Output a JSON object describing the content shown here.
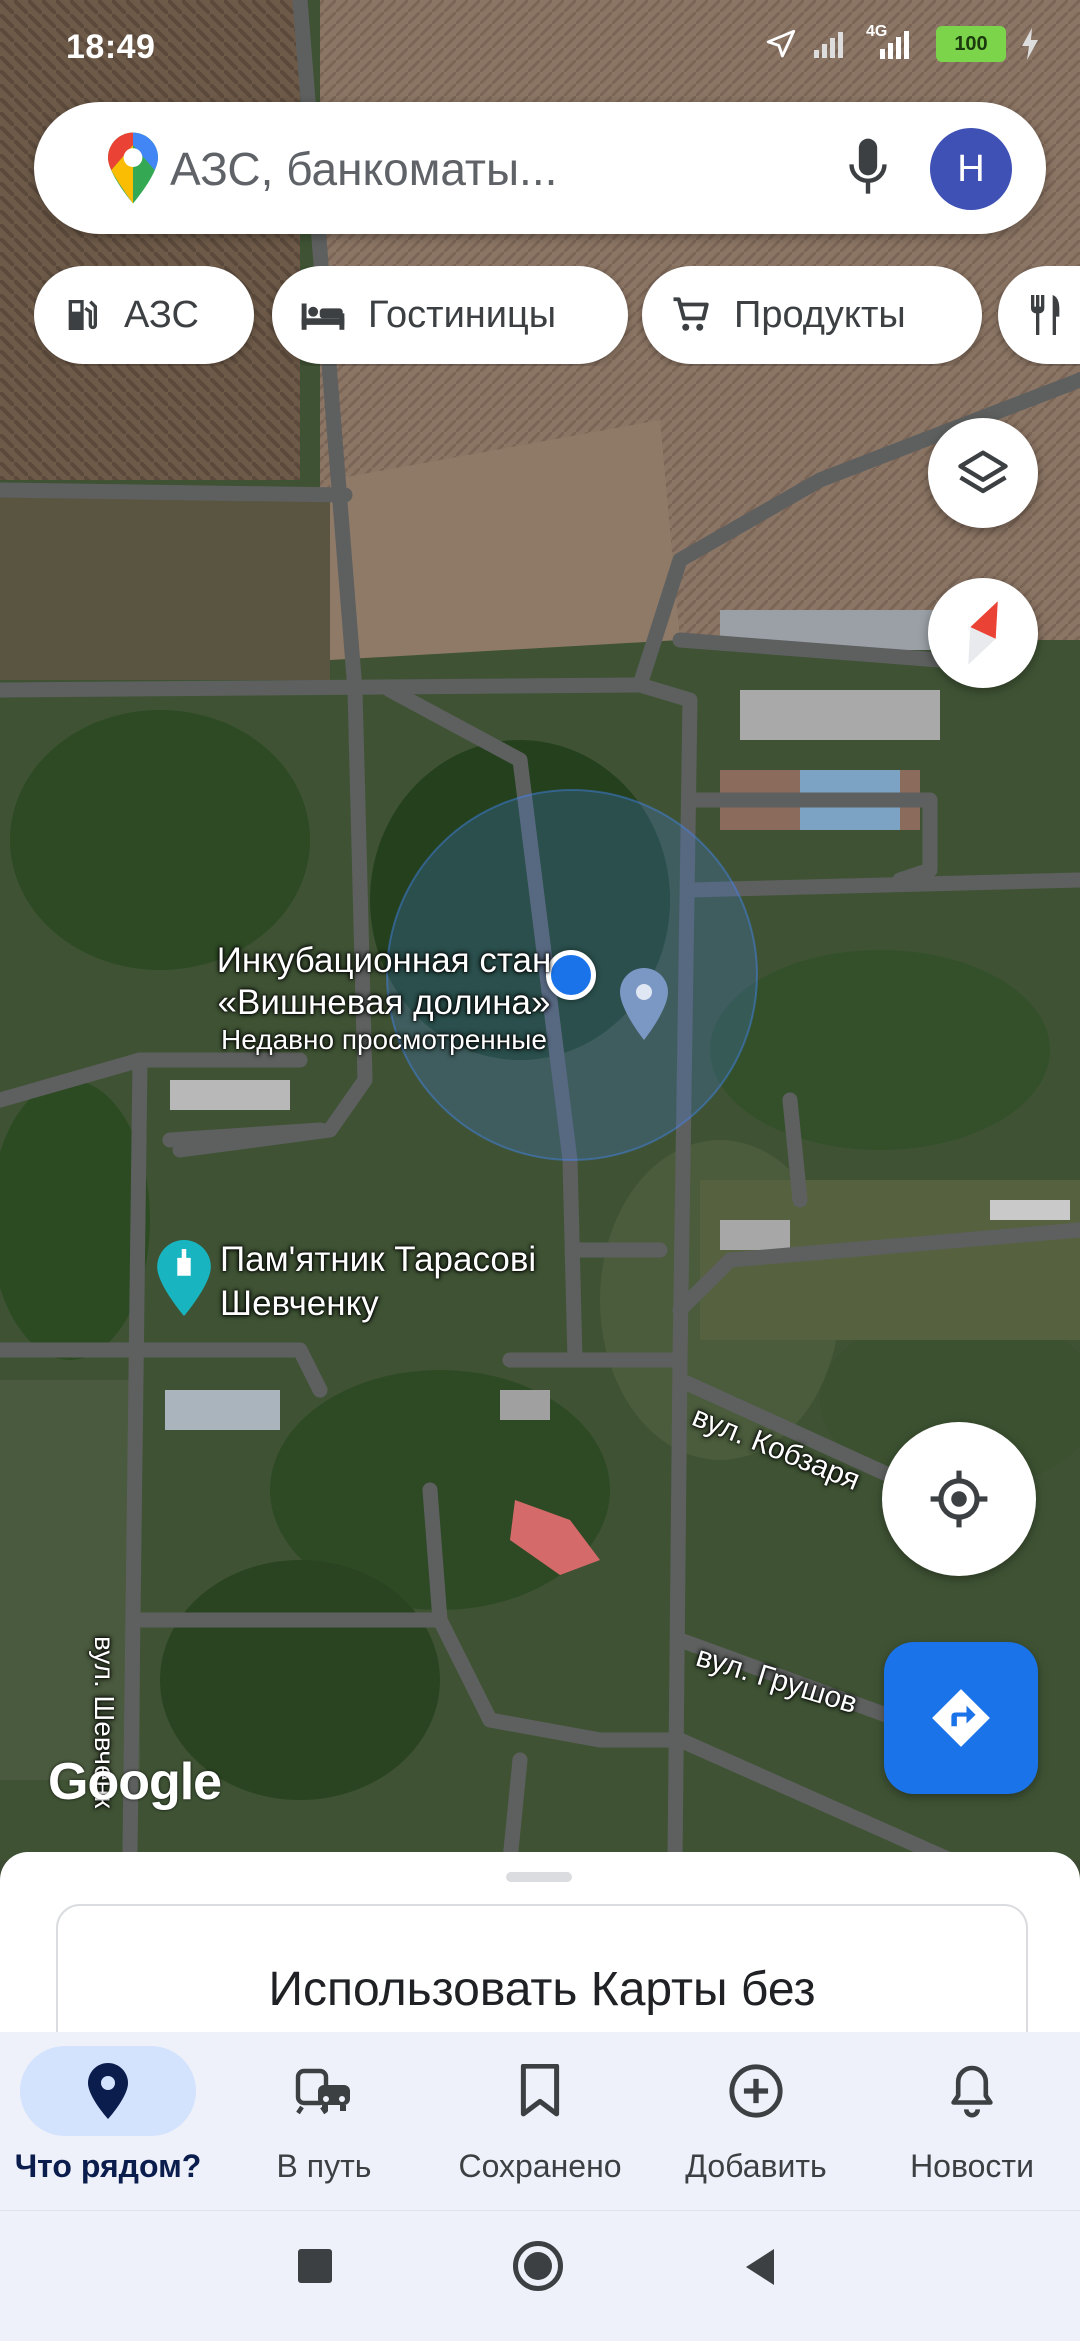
{
  "status_bar": {
    "time": "18:49",
    "network": "4G",
    "battery": "100"
  },
  "search": {
    "placeholder": "АЗС, банкоматы...",
    "avatar_letter": "Н"
  },
  "chips": [
    {
      "label": "АЗС",
      "icon": "gas-station-icon"
    },
    {
      "label": "Гостиницы",
      "icon": "hotel-bed-icon"
    },
    {
      "label": "Продукты",
      "icon": "shopping-cart-icon"
    },
    {
      "label": "",
      "icon": "restaurant-icon"
    }
  ],
  "map": {
    "place_label_line1": "Инкубационная стан",
    "place_label_line2": "«Вишневая долина»",
    "place_sublabel": "Недавно просмотренные",
    "monument_line1": "Пам'ятник Тарасові",
    "monument_line2": "Шевченку",
    "street_kobzar": "вул. Кобзаря",
    "street_grushev": "вул. Грушов",
    "street_shevch": "вул. Шевченк",
    "attribution": "Google"
  },
  "bottom_sheet": {
    "text": "Использовать Карты без"
  },
  "bottom_nav": [
    {
      "label": "Что рядом?",
      "icon": "location-pin-icon",
      "active": true
    },
    {
      "label": "В путь",
      "icon": "commute-icon",
      "active": false
    },
    {
      "label": "Сохранено",
      "icon": "bookmark-icon",
      "active": false
    },
    {
      "label": "Добавить",
      "icon": "add-circle-icon",
      "active": false
    },
    {
      "label": "Новости",
      "icon": "bell-icon",
      "active": false
    }
  ],
  "colors": {
    "accent": "#1a73e8",
    "active_nav_bg": "#d3e3fd",
    "avatar": "#3f51b5"
  }
}
